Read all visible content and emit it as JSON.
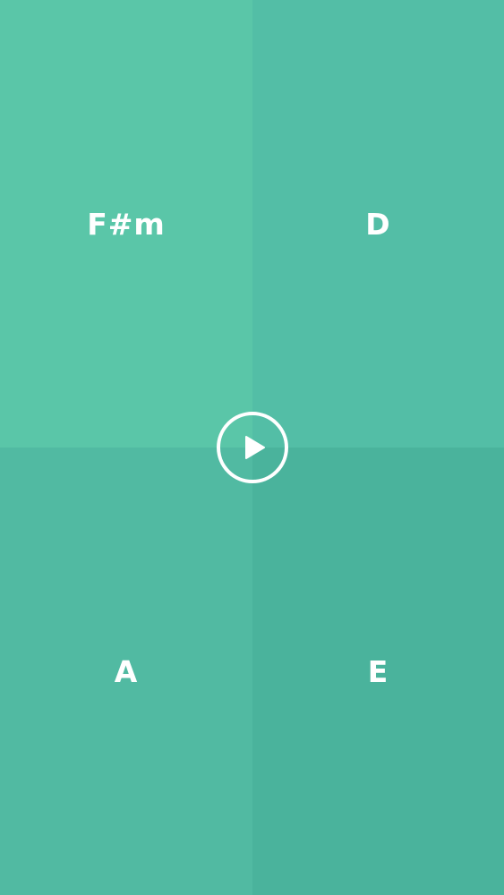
{
  "pads": [
    {
      "chord": "F#m",
      "color": "#5ac6a8"
    },
    {
      "chord": "D",
      "color": "#53bea6"
    },
    {
      "chord": "A",
      "color": "#51baa2"
    },
    {
      "chord": "E",
      "color": "#4ab39c"
    }
  ],
  "play_button": {
    "icon": "play-icon",
    "color": "#ffffff"
  }
}
